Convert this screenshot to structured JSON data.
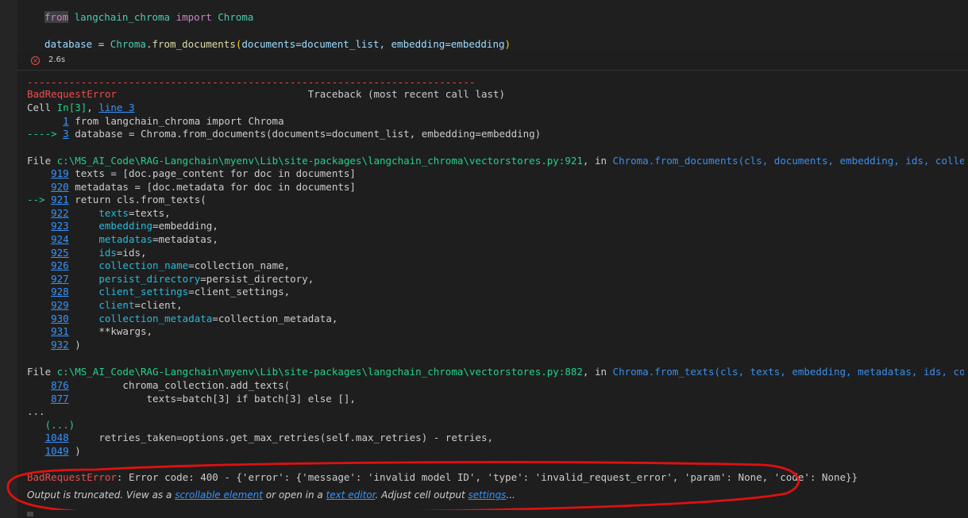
{
  "input": {
    "line1": {
      "from": "from",
      "module": "langchain_chroma",
      "import": "import",
      "cls": "Chroma"
    },
    "line2": {
      "var": "database",
      "eq": " = ",
      "cls": "Chroma",
      "dot": ".",
      "fn": "from_documents",
      "open": "(",
      "args": "documents=document_list, embedding=embedding",
      "close": ")"
    }
  },
  "status": {
    "duration": "2.6s",
    "icon": "error-x-icon"
  },
  "output": {
    "dashes": "---------------------------------------------------------------------------",
    "err_name": "BadRequestError",
    "traceback_label": "                                Traceback (most recent call last)",
    "cell_prefix": "Cell ",
    "cell_ref": "In[3]",
    "cell_comma": ", ",
    "cell_line": "line 3",
    "tb1_l1_num": "1",
    "tb1_l1_text": " from langchain_chroma import Chroma",
    "tb1_l3_arrow": "----> ",
    "tb1_l3_num": "3",
    "tb1_l3_text": " database = Chroma.from_documents(documents=document_list, embedding=embedding)",
    "file1_prefix": "File ",
    "file1_path": "c:\\MS_AI_Code\\RAG-Langchain\\myenv\\Lib\\site-packages\\langchain_chroma\\vectorstores.py:921",
    "file1_in": ", in ",
    "file1_func": "Chroma.from_documents(cls, documents, embedding, ids, collection_name, persist_directory",
    "f1_lines": [
      {
        "pre": "    ",
        "num": "919",
        "text": " texts = [doc.page_content for doc in documents]"
      },
      {
        "pre": "    ",
        "num": "920",
        "text": " metadatas = [doc.metadata for doc in documents]"
      },
      {
        "pre": "--> ",
        "num": "921",
        "text": " return cls.from_texts("
      },
      {
        "pre": "    ",
        "num": "922",
        "text": "     texts=texts,"
      },
      {
        "pre": "    ",
        "num": "923",
        "text": "     embedding=embedding,"
      },
      {
        "pre": "    ",
        "num": "924",
        "text": "     metadatas=metadatas,"
      },
      {
        "pre": "    ",
        "num": "925",
        "text": "     ids=ids,"
      },
      {
        "pre": "    ",
        "num": "926",
        "text": "     collection_name=collection_name,"
      },
      {
        "pre": "    ",
        "num": "927",
        "text": "     persist_directory=persist_directory,"
      },
      {
        "pre": "    ",
        "num": "928",
        "text": "     client_settings=client_settings,"
      },
      {
        "pre": "    ",
        "num": "929",
        "text": "     client=client,"
      },
      {
        "pre": "    ",
        "num": "930",
        "text": "     collection_metadata=collection_metadata,"
      },
      {
        "pre": "    ",
        "num": "931",
        "text": "     **kwargs,"
      },
      {
        "pre": "    ",
        "num": "932",
        "text": " )"
      }
    ],
    "file2_prefix": "File ",
    "file2_path": "c:\\MS_AI_Code\\RAG-Langchain\\myenv\\Lib\\site-packages\\langchain_chroma\\vectorstores.py:882",
    "file2_in": ", in ",
    "file2_func": "Chroma.from_texts(cls, texts, embedding, metadatas, ids, collection_name, persist_directory",
    "f2_lines": [
      {
        "pre": "    ",
        "num": "876",
        "text": "         chroma_collection.add_texts("
      },
      {
        "pre": "    ",
        "num": "877",
        "text": "             texts=batch[3] if batch[3] else [],"
      }
    ],
    "ellipsis": "...",
    "collapsed": "   (...)",
    "f3_lines": [
      {
        "pre": "   ",
        "num": "1048",
        "text": "     retries_taken=options.get_max_retries(self.max_retries) - retries,"
      },
      {
        "pre": "   ",
        "num": "1049",
        "text": " )"
      }
    ],
    "final_err_name": "BadRequestError",
    "final_err_msg": ": Error code: 400 - {'error': {'message': 'invalid model ID', 'type': 'invalid_request_error', 'param': None, 'code': None}}",
    "truncated": {
      "t1": "Output is truncated. View as a ",
      "link1": "scrollable element",
      "t2": " or open in a ",
      "link2": "text editor",
      "t3": ". Adjust cell output ",
      "link3": "settings",
      "t4": "..."
    }
  },
  "colors": {
    "annotation": "#e01010",
    "error": "#f14c4c",
    "link": "#3794ff"
  }
}
